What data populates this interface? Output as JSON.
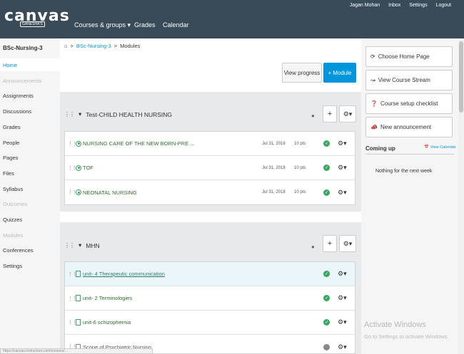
{
  "header": {
    "logo": "canvas",
    "logo_sub": "GANESHA'S",
    "nav": {
      "courses": "Courses & groups ▾",
      "grades": "Grades",
      "calendar": "Calendar"
    },
    "user": {
      "name": "Jagan Mohan",
      "inbox": "Inbox",
      "settings": "Settings",
      "logout": "Logout"
    }
  },
  "course": {
    "code": "BSc-Nursing-3"
  },
  "leftnav": {
    "home": "Home",
    "announcements": "Announcements",
    "assignments": "Assignments",
    "discussions": "Discussions",
    "grades": "Grades",
    "people": "People",
    "pages": "Pages",
    "files": "Files",
    "syllabus": "Syllabus",
    "outcomes": "Outcomes",
    "quizzes": "Quizzes",
    "modules": "Modules",
    "conferences": "Conferences",
    "settings": "Settings"
  },
  "breadcrumb": {
    "home_icon": "home-icon",
    "course": "BSc-Nursing-3",
    "sep": ">",
    "page": "Modules"
  },
  "toolbar": {
    "view_progress": "View progress",
    "add_module": "Module",
    "add_plus": "+"
  },
  "modules": [
    {
      "title": "Test-CHILD HEALTH NURSING",
      "items": [
        {
          "title": "NURSING CARE OF THE NEW BORN-PRE ...",
          "date": "Jul 31, 2018",
          "pts": "10 pts"
        },
        {
          "title": "TOF",
          "date": "Jul 31, 2018",
          "pts": "10 pts"
        },
        {
          "title": "NEONATAL NURSING",
          "date": "Jul 31, 2018",
          "pts": "10 pts"
        }
      ]
    },
    {
      "title": "MHN",
      "items": [
        {
          "title": "unit- 4 Therapeutic communication"
        },
        {
          "title": "unit- 2 Terminologies"
        },
        {
          "title": "unit-6 schizophernia"
        },
        {
          "title": "Scope of Psychiatric Nursing"
        }
      ]
    }
  ],
  "sidebar": {
    "buttons": {
      "home_page": "Choose Home Page",
      "stream": "View Course Stream",
      "checklist": "Course setup checklist",
      "announcement": "New announcement"
    },
    "coming_up": "Coming up",
    "view_calendar": "View Calendar",
    "nothing": "Nothing for the next week"
  },
  "watermark": {
    "line1": "Activate Windows",
    "line2": "Go to Settings to activate Windows."
  },
  "statusbar": "https://canvas.instructure.com/courses/..."
}
